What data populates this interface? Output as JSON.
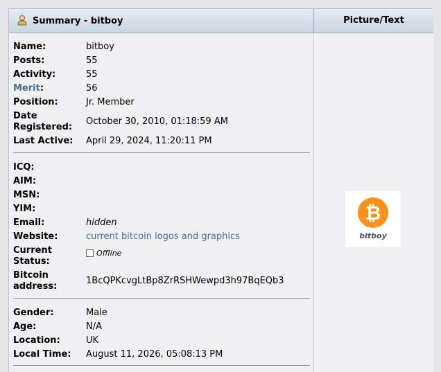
{
  "header": {
    "title": "Summary - bitboy",
    "right_title": "Picture/Text"
  },
  "summary": [
    {
      "label": "Name:",
      "value": "bitboy"
    },
    {
      "label": "Posts:",
      "value": "55"
    },
    {
      "label": "Activity:",
      "value": "55"
    },
    {
      "label": "Merit",
      "label_suffix": ":",
      "value": "56"
    },
    {
      "label": "Position:",
      "value": "Jr. Member"
    },
    {
      "label_line1": "Date",
      "label_line2": "Registered:",
      "value": "October 30, 2010, 01:18:59 AM"
    },
    {
      "label": "Last Active:",
      "value": "April 29, 2024, 11:20:11 PM"
    }
  ],
  "contact": {
    "icq_label": "ICQ:",
    "aim_label": "AIM:",
    "msn_label": "MSN:",
    "yim_label": "YIM:",
    "email_label": "Email:",
    "email_value": "hidden",
    "website_label": "Website:",
    "website_value": "current bitcoin logos and graphics",
    "status_label_line1": "Current",
    "status_label_line2": "Status:",
    "status_value": "Offline",
    "btc_label_line1": "Bitcoin",
    "btc_label_line2": "address:",
    "btc_value": "1BcQPKcvgLtBp8ZrRSHWewpd3h97BqEQb3"
  },
  "personal": [
    {
      "label": "Gender:",
      "value": "Male"
    },
    {
      "label": "Age:",
      "value": "N/A"
    },
    {
      "label": "Location:",
      "value": "UK"
    },
    {
      "label": "Local Time:",
      "value": "August 11, 2026, 05:08:13 PM"
    }
  ],
  "avatar": {
    "caption": "bitboy",
    "symbol": "₿",
    "color": "#f7931a"
  }
}
